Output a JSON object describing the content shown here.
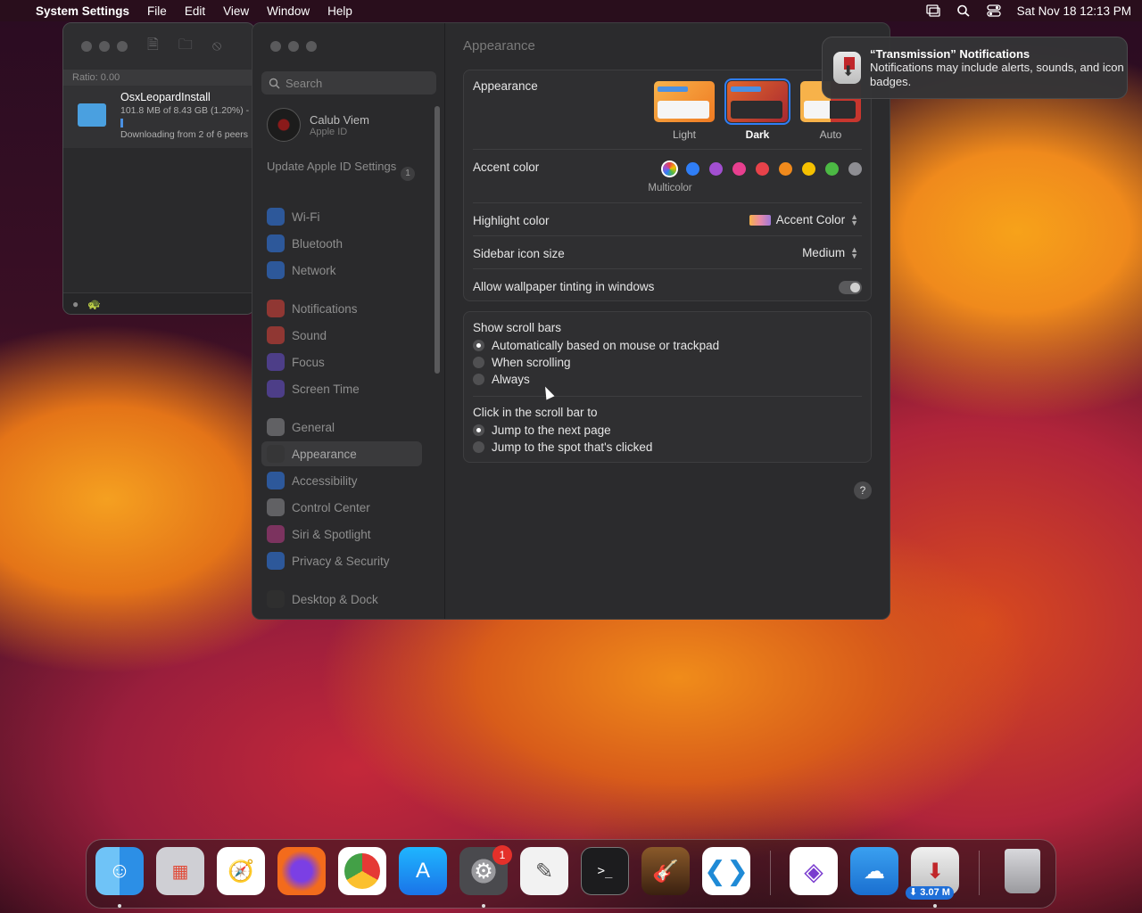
{
  "menubar": {
    "app_name": "System Settings",
    "menus": [
      "File",
      "Edit",
      "View",
      "Window",
      "Help"
    ],
    "clock": "Sat Nov 18  12:13 PM"
  },
  "transmission": {
    "ratio": "Ratio: 0.00",
    "torrent_name": "OsxLeopardInstall",
    "torrent_size": "101.8 MB of 8.43 GB (1.20%) -",
    "torrent_status": "Downloading from 2 of 6 peers",
    "progress": 0.012
  },
  "settings": {
    "search_placeholder": "Search",
    "user_name": "Calub Viem",
    "user_sub": "Apple ID",
    "update_text": "Update Apple ID Settings",
    "update_count": "1",
    "nav": [
      {
        "label": "Wi-Fi",
        "icon": "wifi-icon",
        "color": "#2f7ef6"
      },
      {
        "label": "Bluetooth",
        "icon": "bluetooth-icon",
        "color": "#2f7ef6"
      },
      {
        "label": "Network",
        "icon": "globe-icon",
        "color": "#2f7ef6"
      },
      {
        "label": "Notifications",
        "icon": "bell-icon",
        "color": "#e4413b"
      },
      {
        "label": "Sound",
        "icon": "speaker-icon",
        "color": "#e4413b"
      },
      {
        "label": "Focus",
        "icon": "moon-icon",
        "color": "#6a4fd6"
      },
      {
        "label": "Screen Time",
        "icon": "hourglass-icon",
        "color": "#6a4fd6"
      },
      {
        "label": "General",
        "icon": "gear-icon",
        "color": "#8e8e93"
      },
      {
        "label": "Appearance",
        "icon": "appearance-icon",
        "color": "#333333"
      },
      {
        "label": "Accessibility",
        "icon": "accessibility-icon",
        "color": "#2f7ef6"
      },
      {
        "label": "Control Center",
        "icon": "control-center-icon",
        "color": "#8e8e93"
      },
      {
        "label": "Siri & Spotlight",
        "icon": "siri-icon",
        "color": "#c03a8a"
      },
      {
        "label": "Privacy & Security",
        "icon": "hand-icon",
        "color": "#2f7ef6"
      },
      {
        "label": "Desktop & Dock",
        "icon": "dock-icon",
        "color": "#333333"
      }
    ],
    "page_title": "Appearance",
    "appearance_label": "Appearance",
    "appearance_options": [
      "Light",
      "Dark",
      "Auto"
    ],
    "appearance_selected": "Dark",
    "accent_label": "Accent color",
    "accent_selected_name": "Multicolor",
    "accent_colors": [
      "#ffffff",
      "#2f7ef6",
      "#a24fd1",
      "#e83f8f",
      "#e8424a",
      "#f08a1c",
      "#f5c000",
      "#4cb944",
      "#8e8e93"
    ],
    "highlight_label": "Highlight color",
    "highlight_value": "Accent Color",
    "sidebar_icon_label": "Sidebar icon size",
    "sidebar_icon_value": "Medium",
    "tinting_label": "Allow wallpaper tinting in windows",
    "scrollbars_label": "Show scroll bars",
    "scrollbar_options": [
      "Automatically based on mouse or trackpad",
      "When scrolling",
      "Always"
    ],
    "click_label": "Click in the scroll bar to",
    "click_options": [
      "Jump to the next page",
      "Jump to the spot that's clicked"
    ],
    "help": "?"
  },
  "notification": {
    "title": "“Transmission” Notifications",
    "body": "Notifications may include alerts, sounds, and icon badges."
  },
  "dock": {
    "settings_badge": "1",
    "download_rate": "⬇ 3.07 M"
  }
}
